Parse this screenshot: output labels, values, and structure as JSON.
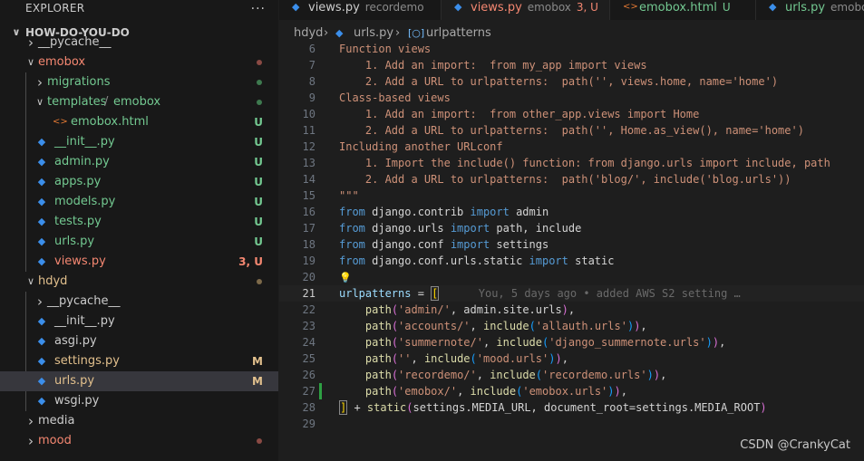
{
  "sidebar": {
    "header": "EXPLORER",
    "more_icon": "...",
    "root": "HOW-DO-YOU-DO",
    "items": [
      {
        "label": "__pycache__",
        "badge": "",
        "color": "#cccccc",
        "dot": ""
      },
      {
        "label": "emobox",
        "badge": "",
        "color": "#f48771",
        "dot": "#8a4a44"
      },
      {
        "label": "migrations",
        "badge": "",
        "color": "#73c991",
        "dot": "#3e7a4f"
      },
      {
        "label": "templates",
        "label2": "emobox",
        "badge": "",
        "color": "#73c991",
        "dot": "#3e7a4f"
      },
      {
        "label": "emobox.html",
        "badge": "U",
        "color": "#73c991",
        "dot": ""
      },
      {
        "label": "__init__.py",
        "badge": "U",
        "color": "#73c991",
        "dot": ""
      },
      {
        "label": "admin.py",
        "badge": "U",
        "color": "#73c991",
        "dot": ""
      },
      {
        "label": "apps.py",
        "badge": "U",
        "color": "#73c991",
        "dot": ""
      },
      {
        "label": "models.py",
        "badge": "U",
        "color": "#73c991",
        "dot": ""
      },
      {
        "label": "tests.py",
        "badge": "U",
        "color": "#73c991",
        "dot": ""
      },
      {
        "label": "urls.py",
        "badge": "U",
        "color": "#73c991",
        "dot": ""
      },
      {
        "label": "views.py",
        "badge": "3, U",
        "color": "#f48771",
        "dot": ""
      },
      {
        "label": "hdyd",
        "badge": "",
        "color": "#e2c08d",
        "dot": "#7d6a4a"
      },
      {
        "label": "__pycache__",
        "badge": "",
        "color": "#cccccc",
        "dot": ""
      },
      {
        "label": "__init__.py",
        "badge": "",
        "color": "#cccccc",
        "dot": ""
      },
      {
        "label": "asgi.py",
        "badge": "",
        "color": "#cccccc",
        "dot": ""
      },
      {
        "label": "settings.py",
        "badge": "M",
        "color": "#e2c08d",
        "dot": ""
      },
      {
        "label": "urls.py",
        "badge": "M",
        "color": "#e2c08d",
        "dot": ""
      },
      {
        "label": "wsgi.py",
        "badge": "",
        "color": "#cccccc",
        "dot": ""
      },
      {
        "label": "media",
        "badge": "",
        "color": "#cccccc",
        "dot": ""
      },
      {
        "label": "mood",
        "badge": "",
        "color": "#f48771",
        "dot": "#8a4a44"
      }
    ]
  },
  "tabs": [
    {
      "name": "views.py",
      "desc": "recordemo",
      "status": "",
      "color": "#cccccc"
    },
    {
      "name": "views.py",
      "desc": "emobox",
      "status": "3, U",
      "color": "#f48771"
    },
    {
      "name": "emobox.html",
      "desc": "",
      "status": "U",
      "color": "#73c991"
    },
    {
      "name": "urls.py",
      "desc": "emobox",
      "status": "",
      "color": "#73c991"
    }
  ],
  "breadcrumb": {
    "folder": "hdyd",
    "sep": "›",
    "file": "urls.py",
    "symbol": "urlpatterns"
  },
  "editor": {
    "lines": [
      {
        "n": "6",
        "text": "Function views"
      },
      {
        "n": "7",
        "text": "    1. Add an import:  from my_app import views"
      },
      {
        "n": "8",
        "text": "    2. Add a URL to urlpatterns:  path('', views.home, name='home')"
      },
      {
        "n": "9",
        "text": "Class-based views"
      },
      {
        "n": "10",
        "text": "    1. Add an import:  from other_app.views import Home"
      },
      {
        "n": "11",
        "text": "    2. Add a URL to urlpatterns:  path('', Home.as_view(), name='home')"
      },
      {
        "n": "12",
        "text": "Including another URLconf"
      },
      {
        "n": "13",
        "text": "    1. Import the include() function: from django.urls import include, path"
      },
      {
        "n": "14",
        "text": "    2. Add a URL to urlpatterns:  path('blog/', include('blog.urls'))"
      },
      {
        "n": "15",
        "text": "\"\"\""
      },
      {
        "n": "16",
        "kw1": "from",
        "mod": " django.contrib ",
        "kw2": "import",
        "rest": " admin"
      },
      {
        "n": "17",
        "kw1": "from",
        "mod": " django.urls ",
        "kw2": "import",
        "rest": " path, include"
      },
      {
        "n": "18",
        "kw1": "from",
        "mod": " django.conf ",
        "kw2": "import",
        "rest": " settings"
      },
      {
        "n": "19",
        "kw1": "from",
        "mod": " django.conf.urls.static ",
        "kw2": "import",
        "rest": " static"
      },
      {
        "n": "20",
        "text": ""
      },
      {
        "n": "21",
        "text": "urlpatterns = [",
        "blame": "You, 5 days ago • added AWS S2 setting …"
      },
      {
        "n": "22",
        "route": "'admin/'",
        "target": "admin.site.urls",
        "inc": false
      },
      {
        "n": "23",
        "route": "'accounts/'",
        "target": "'allauth.urls'",
        "inc": true
      },
      {
        "n": "24",
        "route": "'summernote/'",
        "target": "'django_summernote.urls'",
        "inc": true
      },
      {
        "n": "25",
        "route": "''",
        "target": "'mood.urls'",
        "inc": true
      },
      {
        "n": "26",
        "route": "'recordemo/'",
        "target": "'recordemo.urls'",
        "inc": true
      },
      {
        "n": "27",
        "route": "'emobox/'",
        "target": "'emobox.urls'",
        "inc": true
      },
      {
        "n": "28",
        "text": "] + static(settings.MEDIA_URL, document_root=settings.MEDIA_ROOT)"
      },
      {
        "n": "29",
        "text": ""
      }
    ],
    "lightbulb_icon": "lightbulb-icon"
  },
  "watermark": "CSDN @CrankyCat"
}
